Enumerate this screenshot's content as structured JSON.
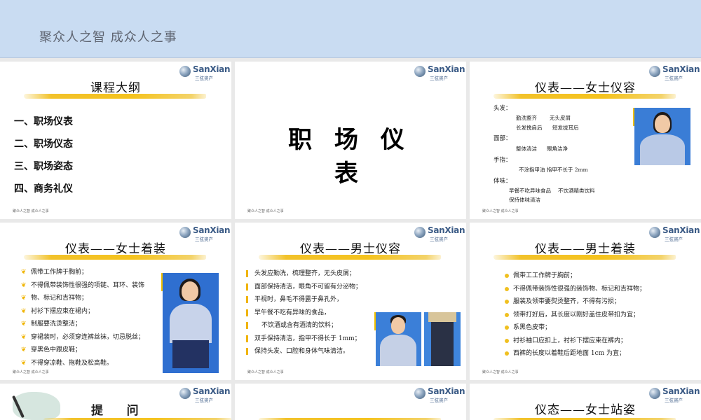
{
  "header": {
    "title": "聚众人之智 成众人之事"
  },
  "logo": {
    "text": "SanXian",
    "sub": "三弦资产"
  },
  "footer": "聚众人之智 成众人之事",
  "slides": {
    "s1": {
      "title": "课程大纲",
      "items": [
        "一、职场仪表",
        "二、职场仪态",
        "三、职场姿态",
        "四、商务礼仪"
      ]
    },
    "s2": {
      "title": "职 场 仪 表"
    },
    "s3": {
      "title": "仪表——女士仪容",
      "hair_label": "头发：",
      "hair_1a": "勤洗整齐",
      "hair_1b": "无头皮屑",
      "hair_2a": "长发挽肩后",
      "hair_2b": "短发拢耳后",
      "face_label": "面部：",
      "face_1a": "整体清洁",
      "face_1b": "眼角洁净",
      "hand_label": "手指：",
      "hand_1": "不涂指甲油  指甲不长于 2mm",
      "body_label": "体味：",
      "body_1a": "早餐不吃异味食品",
      "body_1b": "不饮酒精类饮料",
      "body_2": "保持体味清洁"
    },
    "s4": {
      "title": "仪表——女士着装",
      "items": [
        "佩带工作牌于胸前；",
        "不得佩带装饰性很强的项链、耳环、装饰",
        "物、标记和吉祥物；",
        "衬衫下摆应束在裙内；",
        "制服要洗烫整洁；",
        "穿裙装时，必须穿连裤丝袜，切忌脱丝；",
        "穿黑色中跟皮鞋；",
        "不得穿凉鞋、拖鞋及松高鞋。"
      ]
    },
    "s5": {
      "title": "仪表——男士仪容",
      "items": [
        "头发应勤洗，梳理整齐，无头皮屑；",
        "面部保持清洁，眼角不可留有分泌物；",
        "平视时，鼻毛不得露于鼻孔外，",
        "早午餐不吃有异味的食品，",
        "不饮酒或含有酒清的饮料；",
        "双手保持清洁，指甲不得长于 1mm；",
        "保持头发、口腔和身体气味清洁。"
      ]
    },
    "s6": {
      "title": "仪表——男士着装",
      "items": [
        "佩带工工作牌于胸前；",
        "不得佩带装饰性很强的装饰物、标记和吉祥物；",
        "服装及领带要熨烫整齐，不得有污损；",
        "领带打好后，其长度以刚好盖住皮带扣为宜；",
        "系黑色皮带；",
        "衬衫袖口应扣上，衬衫下摆应束在裤内；",
        "西裤的长度以着鞋后距地面 1cm 为宜；"
      ]
    },
    "s7": {
      "title": "提    问"
    },
    "s9": {
      "title": "仪态——女士站姿"
    }
  }
}
